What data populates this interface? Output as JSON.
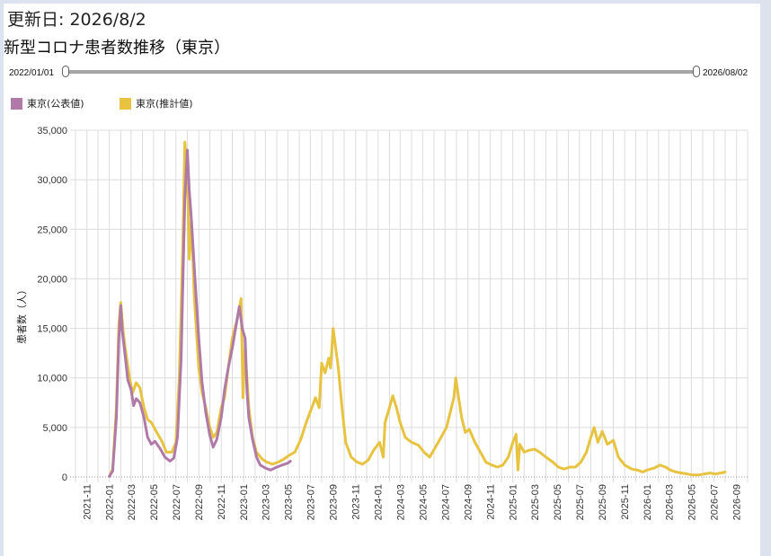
{
  "header": {
    "updated": "更新日: 2026/8/2",
    "title": "新型コロナ患者数推移（東京）"
  },
  "range": {
    "start": "2022/01/01",
    "end": "2026/08/02"
  },
  "legend": [
    {
      "label": "東京(公表値)",
      "color": "#b07aa8"
    },
    {
      "label": "東京(推計値)",
      "color": "#e8c33f"
    }
  ],
  "chart_data": {
    "type": "line",
    "ylabel": "患者数（人）",
    "ylim": [
      0,
      35000
    ],
    "y_ticks": [
      0,
      5000,
      10000,
      15000,
      20000,
      25000,
      30000,
      35000
    ],
    "y_tick_labels": [
      "0",
      "5,000",
      "10,000",
      "15,000",
      "20,000",
      "25,000",
      "30,000",
      "35,000"
    ],
    "x_range": [
      "2021-10-01",
      "2026-10-01"
    ],
    "x_tick_labels": [
      "2021-11",
      "2022-01",
      "2022-03",
      "2022-05",
      "2022-07",
      "2022-09",
      "2022-11",
      "2023-01",
      "2023-03",
      "2023-05",
      "2023-07",
      "2023-09",
      "2023-11",
      "2024-01",
      "2024-03",
      "2024-05",
      "2024-07",
      "2024-09",
      "2024-11",
      "2025-01",
      "2025-03",
      "2025-05",
      "2025-07",
      "2025-09",
      "2025-11",
      "2026-01",
      "2026-03",
      "2026-05",
      "2026-07",
      "2026-09"
    ],
    "grid": true,
    "series": [
      {
        "name": "東京(公表値)",
        "color": "#b07aa8",
        "points": [
          [
            "2022-01-01",
            50
          ],
          [
            "2022-01-10",
            600
          ],
          [
            "2022-01-20",
            6000
          ],
          [
            "2022-01-27",
            14000
          ],
          [
            "2022-02-01",
            17300
          ],
          [
            "2022-02-05",
            14800
          ],
          [
            "2022-02-12",
            12500
          ],
          [
            "2022-02-20",
            9800
          ],
          [
            "2022-03-01",
            8800
          ],
          [
            "2022-03-08",
            7200
          ],
          [
            "2022-03-15",
            7900
          ],
          [
            "2022-03-25",
            7500
          ],
          [
            "2022-04-05",
            6000
          ],
          [
            "2022-04-15",
            4000
          ],
          [
            "2022-04-25",
            3300
          ],
          [
            "2022-05-05",
            3600
          ],
          [
            "2022-05-20",
            2800
          ],
          [
            "2022-06-01",
            2000
          ],
          [
            "2022-06-15",
            1600
          ],
          [
            "2022-06-25",
            1900
          ],
          [
            "2022-07-05",
            4000
          ],
          [
            "2022-07-15",
            12000
          ],
          [
            "2022-07-20",
            20000
          ],
          [
            "2022-07-25",
            28000
          ],
          [
            "2022-08-01",
            33000
          ],
          [
            "2022-08-06",
            29000
          ],
          [
            "2022-08-12",
            26000
          ],
          [
            "2022-08-20",
            21000
          ],
          [
            "2022-09-01",
            14000
          ],
          [
            "2022-09-10",
            9500
          ],
          [
            "2022-09-20",
            6500
          ],
          [
            "2022-10-01",
            4200
          ],
          [
            "2022-10-10",
            3000
          ],
          [
            "2022-10-20",
            3800
          ],
          [
            "2022-11-01",
            6000
          ],
          [
            "2022-11-10",
            8800
          ],
          [
            "2022-11-20",
            11000
          ],
          [
            "2022-12-01",
            13000
          ],
          [
            "2022-12-10",
            15000
          ],
          [
            "2022-12-20",
            17200
          ],
          [
            "2022-12-28",
            15000
          ],
          [
            "2023-01-05",
            14000
          ],
          [
            "2023-01-10",
            8600
          ],
          [
            "2023-01-15",
            6000
          ],
          [
            "2023-01-25",
            3800
          ],
          [
            "2023-02-05",
            2000
          ],
          [
            "2023-02-15",
            1200
          ],
          [
            "2023-03-01",
            900
          ],
          [
            "2023-03-15",
            700
          ],
          [
            "2023-04-01",
            1000
          ],
          [
            "2023-04-15",
            1200
          ],
          [
            "2023-05-01",
            1400
          ],
          [
            "2023-05-08",
            1600
          ]
        ]
      },
      {
        "name": "東京(推計値)",
        "color": "#e8c33f",
        "points": [
          [
            "2022-01-01",
            80
          ],
          [
            "2022-01-10",
            800
          ],
          [
            "2022-01-20",
            7000
          ],
          [
            "2022-01-27",
            15500
          ],
          [
            "2022-02-01",
            17600
          ],
          [
            "2022-02-08",
            14500
          ],
          [
            "2022-02-15",
            12500
          ],
          [
            "2022-02-25",
            10000
          ],
          [
            "2022-03-05",
            8500
          ],
          [
            "2022-03-15",
            9500
          ],
          [
            "2022-03-25",
            9000
          ],
          [
            "2022-04-05",
            7000
          ],
          [
            "2022-04-15",
            5800
          ],
          [
            "2022-04-25",
            5500
          ],
          [
            "2022-05-10",
            4500
          ],
          [
            "2022-05-25",
            3500
          ],
          [
            "2022-06-05",
            2500
          ],
          [
            "2022-06-20",
            2500
          ],
          [
            "2022-07-01",
            3500
          ],
          [
            "2022-07-10",
            10000
          ],
          [
            "2022-07-20",
            24000
          ],
          [
            "2022-07-25",
            33800
          ],
          [
            "2022-08-01",
            31000
          ],
          [
            "2022-08-06",
            22000
          ],
          [
            "2022-08-12",
            26000
          ],
          [
            "2022-08-20",
            18000
          ],
          [
            "2022-09-01",
            11000
          ],
          [
            "2022-09-10",
            8500
          ],
          [
            "2022-09-20",
            7000
          ],
          [
            "2022-10-01",
            5000
          ],
          [
            "2022-10-10",
            4000
          ],
          [
            "2022-10-20",
            4500
          ],
          [
            "2022-11-01",
            7000
          ],
          [
            "2022-11-10",
            8000
          ],
          [
            "2022-11-20",
            11000
          ],
          [
            "2022-12-01",
            14000
          ],
          [
            "2022-12-15",
            16000
          ],
          [
            "2022-12-25",
            18000
          ],
          [
            "2022-12-30",
            8000
          ],
          [
            "2023-01-05",
            13000
          ],
          [
            "2023-01-15",
            7000
          ],
          [
            "2023-01-25",
            4000
          ],
          [
            "2023-02-05",
            2500
          ],
          [
            "2023-02-20",
            1800
          ],
          [
            "2023-03-05",
            1500
          ],
          [
            "2023-03-20",
            1300
          ],
          [
            "2023-04-05",
            1500
          ],
          [
            "2023-04-20",
            1800
          ],
          [
            "2023-05-05",
            2200
          ],
          [
            "2023-05-20",
            2500
          ],
          [
            "2023-06-05",
            3800
          ],
          [
            "2023-06-20",
            5500
          ],
          [
            "2023-07-05",
            7000
          ],
          [
            "2023-07-15",
            8000
          ],
          [
            "2023-07-25",
            7000
          ],
          [
            "2023-08-01",
            11500
          ],
          [
            "2023-08-10",
            10500
          ],
          [
            "2023-08-20",
            12000
          ],
          [
            "2023-08-25",
            11000
          ],
          [
            "2023-09-01",
            15000
          ],
          [
            "2023-09-08",
            13000
          ],
          [
            "2023-09-15",
            11000
          ],
          [
            "2023-09-25",
            7000
          ],
          [
            "2023-10-05",
            3500
          ],
          [
            "2023-10-20",
            2000
          ],
          [
            "2023-11-05",
            1500
          ],
          [
            "2023-11-20",
            1300
          ],
          [
            "2023-12-05",
            1700
          ],
          [
            "2023-12-20",
            2700
          ],
          [
            "2024-01-05",
            3500
          ],
          [
            "2024-01-15",
            2000
          ],
          [
            "2024-01-20",
            5500
          ],
          [
            "2024-02-01",
            7000
          ],
          [
            "2024-02-10",
            8200
          ],
          [
            "2024-02-20",
            7000
          ],
          [
            "2024-03-01",
            5500
          ],
          [
            "2024-03-15",
            4000
          ],
          [
            "2024-04-01",
            3500
          ],
          [
            "2024-04-20",
            3200
          ],
          [
            "2024-05-05",
            2500
          ],
          [
            "2024-05-20",
            2000
          ],
          [
            "2024-06-05",
            3000
          ],
          [
            "2024-06-20",
            4000
          ],
          [
            "2024-07-05",
            5000
          ],
          [
            "2024-07-15",
            6500
          ],
          [
            "2024-07-25",
            8000
          ],
          [
            "2024-07-30",
            10000
          ],
          [
            "2024-08-05",
            8500
          ],
          [
            "2024-08-15",
            6000
          ],
          [
            "2024-08-25",
            4500
          ],
          [
            "2024-09-05",
            4800
          ],
          [
            "2024-09-20",
            3500
          ],
          [
            "2024-10-05",
            2500
          ],
          [
            "2024-10-20",
            1500
          ],
          [
            "2024-11-05",
            1200
          ],
          [
            "2024-11-20",
            1000
          ],
          [
            "2024-12-05",
            1200
          ],
          [
            "2024-12-20",
            2000
          ],
          [
            "2025-01-01",
            3500
          ],
          [
            "2025-01-10",
            4300
          ],
          [
            "2025-01-15",
            700
          ],
          [
            "2025-01-20",
            3300
          ],
          [
            "2025-02-01",
            2500
          ],
          [
            "2025-02-15",
            2700
          ],
          [
            "2025-03-01",
            2800
          ],
          [
            "2025-03-15",
            2500
          ],
          [
            "2025-04-01",
            2000
          ],
          [
            "2025-04-20",
            1500
          ],
          [
            "2025-05-05",
            1000
          ],
          [
            "2025-05-20",
            800
          ],
          [
            "2025-06-05",
            1000
          ],
          [
            "2025-06-20",
            1000
          ],
          [
            "2025-07-05",
            1500
          ],
          [
            "2025-07-20",
            2500
          ],
          [
            "2025-08-01",
            4000
          ],
          [
            "2025-08-10",
            5000
          ],
          [
            "2025-08-20",
            3500
          ],
          [
            "2025-09-01",
            4600
          ],
          [
            "2025-09-15",
            3300
          ],
          [
            "2025-10-01",
            3700
          ],
          [
            "2025-10-15",
            2000
          ],
          [
            "2025-11-01",
            1200
          ],
          [
            "2025-11-20",
            800
          ],
          [
            "2025-12-05",
            700
          ],
          [
            "2025-12-20",
            500
          ],
          [
            "2026-01-01",
            700
          ],
          [
            "2026-01-20",
            900
          ],
          [
            "2026-02-05",
            1200
          ],
          [
            "2026-02-20",
            1000
          ],
          [
            "2026-03-05",
            700
          ],
          [
            "2026-03-20",
            500
          ],
          [
            "2026-04-05",
            400
          ],
          [
            "2026-04-20",
            300
          ],
          [
            "2026-05-05",
            200
          ],
          [
            "2026-05-20",
            200
          ],
          [
            "2026-06-05",
            300
          ],
          [
            "2026-06-20",
            400
          ],
          [
            "2026-07-05",
            300
          ],
          [
            "2026-07-20",
            400
          ],
          [
            "2026-08-01",
            500
          ]
        ]
      }
    ]
  }
}
